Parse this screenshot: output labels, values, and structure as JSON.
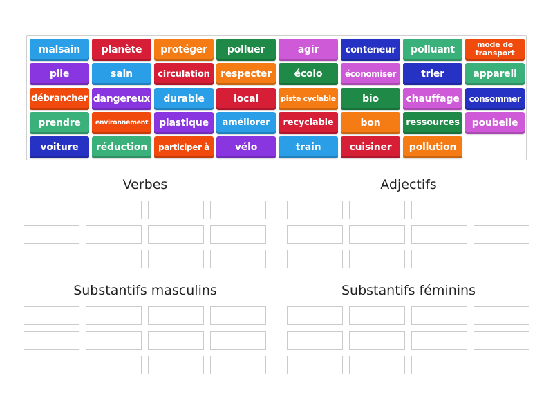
{
  "tiles": [
    {
      "label": "malsain",
      "color": "#2a9ee6"
    },
    {
      "label": "planète",
      "color": "#d61e36"
    },
    {
      "label": "protéger",
      "color": "#f57c14"
    },
    {
      "label": "polluer",
      "color": "#1f8a47"
    },
    {
      "label": "agir",
      "color": "#cf5ad8"
    },
    {
      "label": "conteneur",
      "color": "#2532c4"
    },
    {
      "label": "polluant",
      "color": "#3ab07a"
    },
    {
      "label": "mode de transport",
      "color": "#f04a0c"
    },
    {
      "label": "pile",
      "color": "#8a36e0"
    },
    {
      "label": "sain",
      "color": "#2a9ee6"
    },
    {
      "label": "circulation",
      "color": "#d61e36"
    },
    {
      "label": "respecter",
      "color": "#f57c14"
    },
    {
      "label": "écolo",
      "color": "#1f8a47"
    },
    {
      "label": "économiser",
      "color": "#cf5ad8"
    },
    {
      "label": "trier",
      "color": "#2532c4"
    },
    {
      "label": "appareil",
      "color": "#3ab07a"
    },
    {
      "label": "débrancher",
      "color": "#f04a0c"
    },
    {
      "label": "dangereux",
      "color": "#8a36e0"
    },
    {
      "label": "durable",
      "color": "#2a9ee6"
    },
    {
      "label": "local",
      "color": "#d61e36"
    },
    {
      "label": "piste cyclable",
      "color": "#f57c14"
    },
    {
      "label": "bio",
      "color": "#1f8a47"
    },
    {
      "label": "chauffage",
      "color": "#cf5ad8"
    },
    {
      "label": "consommer",
      "color": "#2532c4"
    },
    {
      "label": "prendre",
      "color": "#3ab07a"
    },
    {
      "label": "environnement",
      "color": "#f04a0c"
    },
    {
      "label": "plastique",
      "color": "#8a36e0"
    },
    {
      "label": "améliorer",
      "color": "#2a9ee6"
    },
    {
      "label": "recyclable",
      "color": "#d61e36"
    },
    {
      "label": "bon",
      "color": "#f57c14"
    },
    {
      "label": "ressources",
      "color": "#1f8a47"
    },
    {
      "label": "poubelle",
      "color": "#cf5ad8"
    },
    {
      "label": "voiture",
      "color": "#2532c4"
    },
    {
      "label": "réduction",
      "color": "#3ab07a"
    },
    {
      "label": "participer à",
      "color": "#f04a0c"
    },
    {
      "label": "vélo",
      "color": "#8a36e0"
    },
    {
      "label": "train",
      "color": "#2a9ee6"
    },
    {
      "label": "cuisiner",
      "color": "#d61e36"
    },
    {
      "label": "pollution",
      "color": "#f57c14"
    }
  ],
  "groups": [
    {
      "title": "Verbes"
    },
    {
      "title": "Adjectifs"
    },
    {
      "title": "Substantifs masculins"
    },
    {
      "title": "Substantifs féminins"
    }
  ]
}
